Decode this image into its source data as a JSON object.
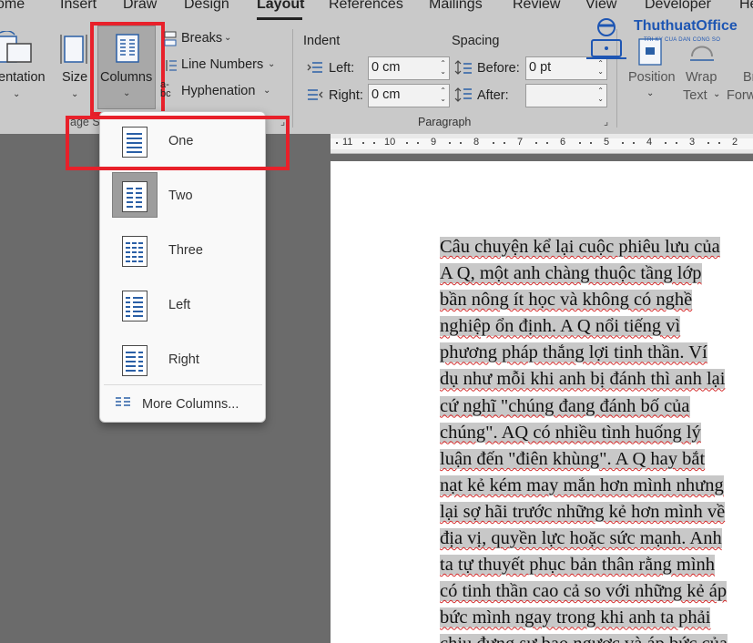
{
  "tabs": [
    {
      "label": "Home",
      "display": "ome"
    },
    {
      "label": "Insert",
      "display": "Insert"
    },
    {
      "label": "Draw",
      "display": "Draw"
    },
    {
      "label": "Design",
      "display": "Design"
    },
    {
      "label": "Layout",
      "display": "Layout",
      "active": true
    },
    {
      "label": "References",
      "display": "References"
    },
    {
      "label": "Mailings",
      "display": "Mailings"
    },
    {
      "label": "Review",
      "display": "Review"
    },
    {
      "label": "View",
      "display": "View"
    },
    {
      "label": "Developer",
      "display": "Developer"
    },
    {
      "label": "Help",
      "display": "He"
    }
  ],
  "page_setup": {
    "orientation_label": "entation",
    "size_label": "Size",
    "columns_label": "Columns",
    "breaks_label": "Breaks",
    "line_numbers_label": "Line Numbers",
    "hyphenation_label": "Hyphenation",
    "group_label": "age S"
  },
  "paragraph": {
    "indent_header": "Indent",
    "spacing_header": "Spacing",
    "left_label": "Left:",
    "left_value": "0 cm",
    "right_label": "Right:",
    "right_value": "0 cm",
    "before_label": "Before:",
    "before_value": "0 pt",
    "after_label": "After:",
    "after_value": "",
    "group_label": "Paragraph"
  },
  "arrange": {
    "position_label": "Position",
    "wrap_label_1": "Wrap",
    "wrap_label_2": "Text",
    "bring_forward_1": "Bri",
    "bring_forward_2": "Forw"
  },
  "logo": {
    "name": "ThuthuatOffice",
    "tagline": "TRI KY CUA DAN CONG SO"
  },
  "columns_menu": {
    "items": [
      {
        "label": "One",
        "icon": "one-column-icon",
        "columns": 1
      },
      {
        "label": "Two",
        "icon": "two-columns-icon",
        "columns": 2,
        "selected": true
      },
      {
        "label": "Three",
        "icon": "three-columns-icon",
        "columns": 3
      },
      {
        "label": "Left",
        "icon": "left-column-icon",
        "columns": "left"
      },
      {
        "label": "Right",
        "icon": "right-column-icon",
        "columns": "right"
      }
    ],
    "more_label": "More Columns..."
  },
  "ruler": {
    "numbers": [
      "11",
      "10",
      "9",
      "8",
      "7",
      "6",
      "5",
      "4",
      "3",
      "2"
    ]
  },
  "document": {
    "lines": [
      "Câu chuyện kể lại cuộc phiêu lưu của",
      "A Q, một anh chàng thuộc tầng lớp",
      "bần nông ít học và không có nghề",
      "nghiệp ổn định. A Q nổi tiếng vì",
      "phương pháp thắng lợi tinh thần. Ví",
      "dụ như mỗi khi anh bị đánh thì anh lại",
      "cứ nghĩ \"chúng đang đánh bố của",
      "chúng\". AQ có nhiều tình huống lý",
      "luận đến \"điên khùng\". A Q hay bắt",
      "nạt kẻ kém may mắn hơn mình nhưng",
      "lại sợ hãi trước những kẻ hơn mình về",
      "địa vị, quyền lực hoặc sức mạnh. Anh",
      "ta tự thuyết phục bản thân rằng mình",
      "có tinh thần cao cả so với những kẻ áp",
      "bức mình ngay trong khi anh ta phải",
      "chịu đựng sự bạo ngược và áp bức của"
    ]
  },
  "colors": {
    "ribbon_bg": "#c9c9c9",
    "accent_red": "#e8202a",
    "icon_blue": "#2a5fa6",
    "workspace_bg": "#6b6b6b"
  }
}
